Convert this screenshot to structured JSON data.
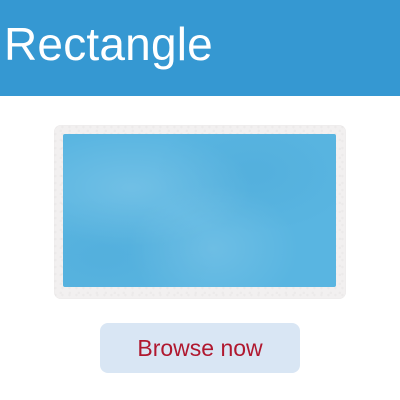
{
  "header": {
    "title": "Rectangle"
  },
  "image": {
    "icon": "rectangle-icon"
  },
  "actions": {
    "browse_label": "Browse now"
  },
  "colors": {
    "header_background": "#3598d2",
    "rectangle_fill": "#59b5e1",
    "button_background": "#d9e6f4",
    "button_text": "#b0182f"
  }
}
